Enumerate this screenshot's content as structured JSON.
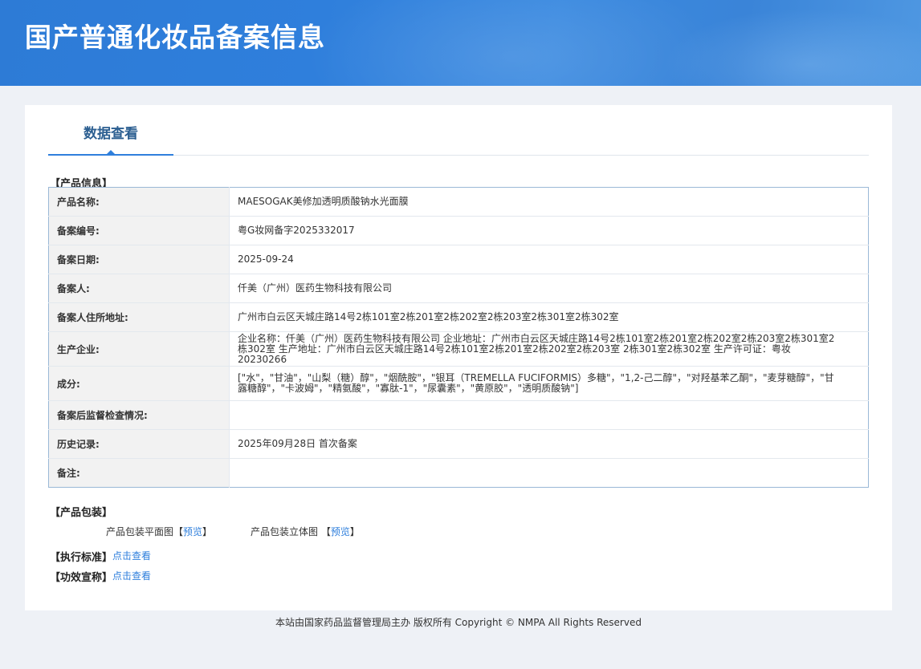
{
  "banner": {
    "title": "国产普通化妆品备案信息"
  },
  "tab": {
    "label": "数据查看"
  },
  "product_info": {
    "heading": "【产品信息】",
    "rows": [
      {
        "key": "产品名称:",
        "value": "MAESOGAK美修加透明质酸钠水光面膜"
      },
      {
        "key": "备案编号:",
        "value": "粤G妆网备字2025332017"
      },
      {
        "key": "备案日期:",
        "value": "2025-09-24"
      },
      {
        "key": "备案人:",
        "value": "仟美（广州）医药生物科技有限公司"
      },
      {
        "key": "备案人住所地址:",
        "value": "广州市白云区天城庄路14号2栋101室2栋201室2栋202室2栋203室2栋301室2栋302室"
      },
      {
        "key": "生产企业:",
        "value": "企业名称：仟美（广州）医药生物科技有限公司 企业地址：广州市白云区天城庄路14号2栋101室2栋201室2栋202室2栋203室2栋301室2栋302室 生产地址：广州市白云区天城庄路14号2栋101室2栋201室2栋202室2栋203室 2栋301室2栋302室 生产许可证：粤妆20230266"
      },
      {
        "key": "成分:",
        "value": "[\"水\"，\"甘油\"，\"山梨（糖）醇\"，\"烟酰胺\"，\"银耳（TREMELLA FUCIFORMIS）多糖\"，\"1,2-己二醇\"，\"对羟基苯乙酮\"，\"麦芽糖醇\"，\"甘露糖醇\"，\"卡波姆\"，\"精氨酸\"，\"寡肽-1\"，\"尿囊素\"，\"黄原胶\"，\"透明质酸钠\"]"
      },
      {
        "key": "备案后监督检查情况:",
        "value": ""
      },
      {
        "key": "历史记录:",
        "value": "2025年09月28日 首次备案"
      },
      {
        "key": "备注:",
        "value": ""
      }
    ]
  },
  "packaging": {
    "heading": "【产品包装】",
    "flat_label": "产品包装平面图",
    "three_d_label": "产品包装立体图",
    "bracket_open": "【",
    "bracket_close": "】",
    "preview_link": "预览"
  },
  "standard": {
    "heading": "【执行标准】",
    "link": "点击查看"
  },
  "efficacy": {
    "heading": "【功效宣称】",
    "link": "点击查看"
  },
  "footer": {
    "text": "本站由国家药品监督管理局主办 版权所有 Copyright © NMPA All Rights Reserved"
  }
}
